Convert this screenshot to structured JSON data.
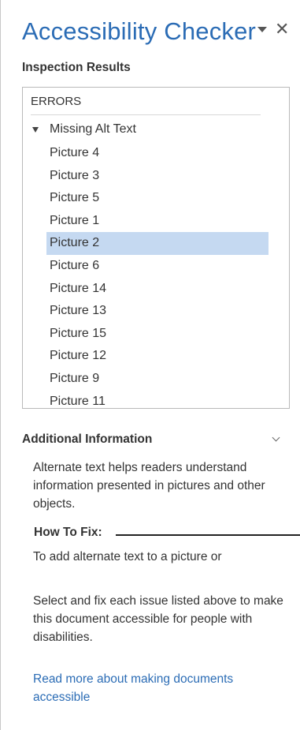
{
  "pane": {
    "title": "Accessibility Checker"
  },
  "inspection": {
    "label": "Inspection Results",
    "errors_header": "ERRORS",
    "group": "Missing Alt Text",
    "items": [
      "Picture 4",
      "Picture 3",
      "Picture 5",
      "Picture 1",
      "Picture 2",
      "Picture 6",
      "Picture 14",
      "Picture 13",
      "Picture 15",
      "Picture 12",
      "Picture 9",
      "Picture 11"
    ],
    "selected_item": "Picture 2"
  },
  "additional": {
    "label": "Additional Information",
    "description": "Alternate text helps readers understand information presented in pictures and other objects.",
    "how_to_fix_label": "How To Fix:",
    "how_to_fix_text": "To add alternate text to a picture or",
    "select_text": "Select and fix each issue listed above to make this document accessible for people with disabilities.",
    "read_more_link": "Read more about making documents accessible"
  },
  "colors": {
    "title": "#2b6cb5",
    "selection": "#c5d9f1",
    "link": "#2b6cb5"
  },
  "icons": {
    "menu": "dropdown-arrow-icon",
    "close": "close-icon",
    "group_toggle": "expand-triangle-icon",
    "collapse": "chevron-down-icon"
  }
}
